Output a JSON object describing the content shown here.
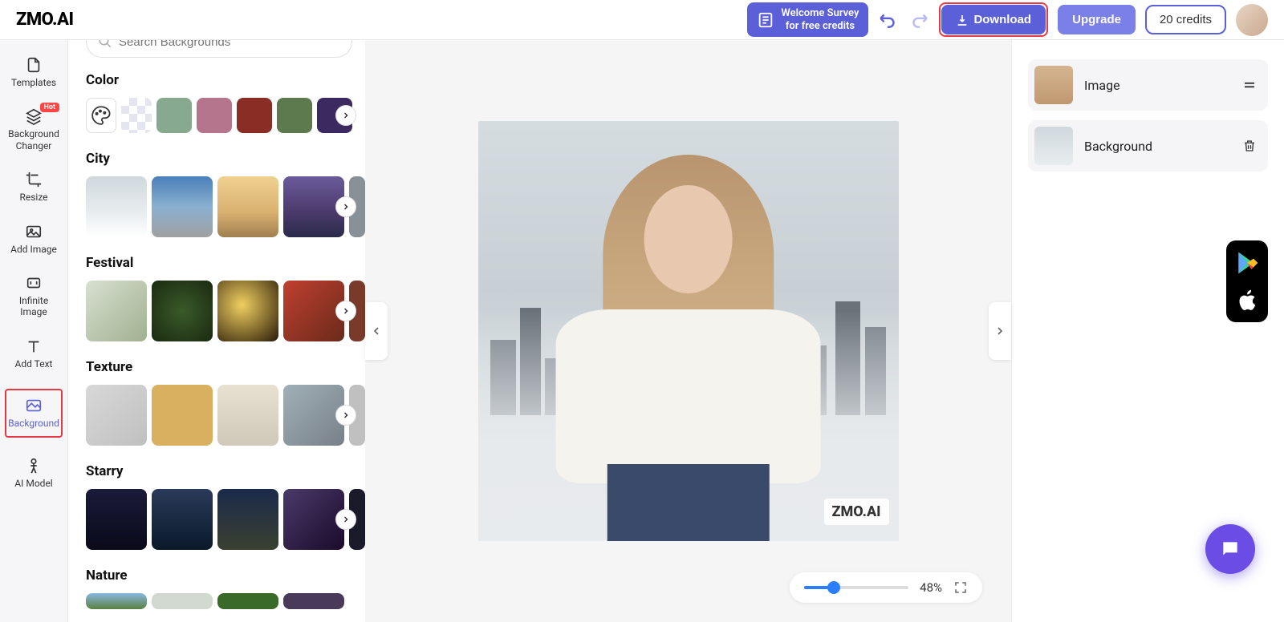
{
  "brand": "ZMO.AI",
  "header": {
    "survey_line1": "Welcome Survey",
    "survey_line2": "for free credits",
    "download": "Download",
    "upgrade": "Upgrade",
    "credits": "20 credits"
  },
  "sidebar": {
    "templates": "Templates",
    "bg_changer": "Background Changer",
    "bg_changer_badge": "Hot",
    "resize": "Resize",
    "add_image": "Add Image",
    "infinite_image": "Infinite Image",
    "add_text": "Add Text",
    "background": "Background",
    "ai_model": "AI Model"
  },
  "panel": {
    "search_placeholder": "Search Backgrounds",
    "sections": {
      "color": "Color",
      "city": "City",
      "festival": "Festival",
      "texture": "Texture",
      "starry": "Starry",
      "nature": "Nature"
    },
    "colors": [
      "#87a98f",
      "#b5758d",
      "#8a2d25",
      "#5d7a4e",
      "#3c2960"
    ]
  },
  "canvas": {
    "watermark": "ZMO.AI",
    "zoom_pct": "48%"
  },
  "layers": {
    "image": "Image",
    "background": "Background"
  }
}
